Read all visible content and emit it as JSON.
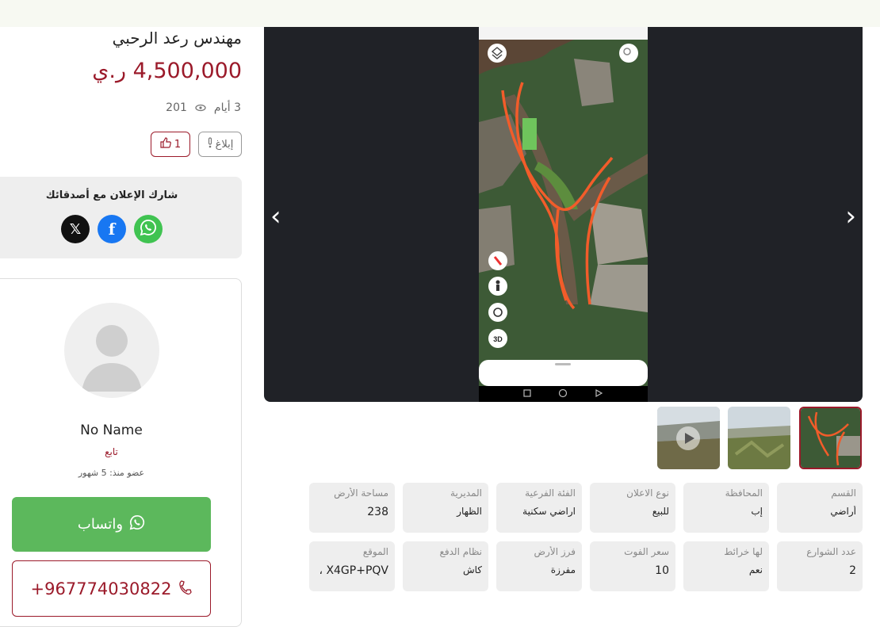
{
  "listing": {
    "title": "مهندس رعد الرحبي",
    "price": "4,500,000 ر.ي",
    "age": "3 أيام",
    "views": "201",
    "report_label": "إبلاغ",
    "likes": "1"
  },
  "share": {
    "title": "شارك الإعلان مع أصدقائك",
    "x_glyph": "𝕏",
    "facebook_glyph": "f"
  },
  "seller": {
    "name": "No Name",
    "role": "تابع",
    "member_since": "عضو منذ: 5 شهور",
    "whatsapp_label": "واتساب",
    "phone": "+967774030822"
  },
  "gallery": {
    "prev_glyph": "‹",
    "next_glyph": "›",
    "phone_badge_3d": "3D",
    "thumbnails": [
      {
        "name": "thumb-1",
        "has_video": true
      },
      {
        "name": "thumb-2",
        "has_video": false
      },
      {
        "name": "thumb-3",
        "has_video": false,
        "active": true
      }
    ]
  },
  "specs": [
    {
      "label": "القسم",
      "value": "أراضي"
    },
    {
      "label": "المحافظة",
      "value": "إب"
    },
    {
      "label": "نوع الاعلان",
      "value": "للبيع"
    },
    {
      "label": "الفئة الفرعية",
      "value": "اراضي سكنية"
    },
    {
      "label": "المديرية",
      "value": "الظهار"
    },
    {
      "label": "مساحة الأرض",
      "value": "238"
    },
    {
      "label": "عدد الشوارع",
      "value": "2"
    },
    {
      "label": "لها خرائط",
      "value": "نعم"
    },
    {
      "label": "سعر الفوت",
      "value": "10"
    },
    {
      "label": "فرز الأرض",
      "value": "مفرزة"
    },
    {
      "label": "نظام الدفع",
      "value": "كاش"
    },
    {
      "label": "الموقع",
      "value": "X4GP+PQV ،"
    }
  ],
  "colors": {
    "accent": "#9b1a2a",
    "whatsapp": "#5cb85c",
    "facebook": "#1877f2",
    "gallery_bg": "#202227",
    "spec_bg": "#eeeeee"
  }
}
